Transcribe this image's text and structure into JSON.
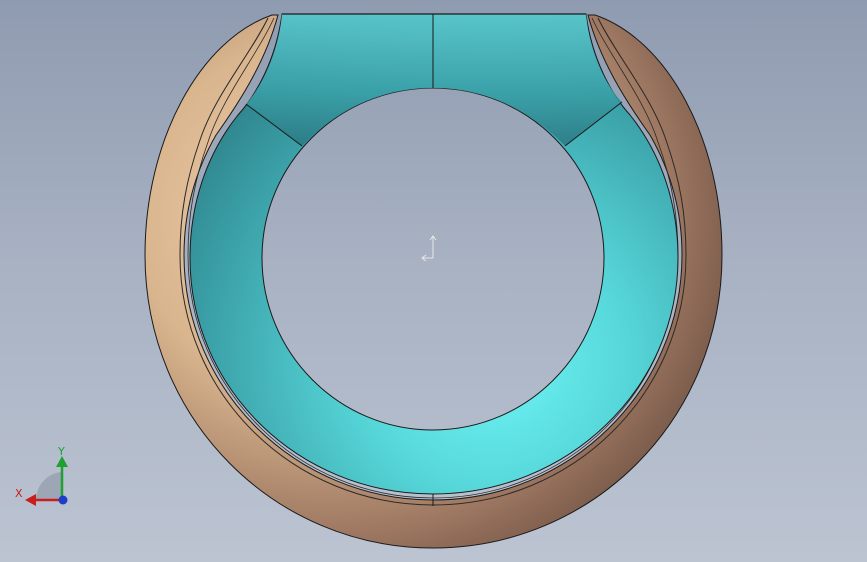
{
  "viewport": {
    "background_top": "#8f9bb0",
    "background_bottom": "#bcc4d2"
  },
  "model": {
    "outer_shell_color": "#d9b58e",
    "outer_shell_shadow": "#6f5244",
    "inner_liner_color": "#56d6d8",
    "inner_liner_shadow": "#2b7a83",
    "edge_color": "#1a1a1a"
  },
  "triad": {
    "x_label": "X",
    "y_label": "Y",
    "x_color": "#c81e1e",
    "y_color": "#20a030",
    "z_color": "#1d3cc8"
  },
  "origin_marker": {
    "icon": "origin-icon",
    "color": "#e8e8e8"
  }
}
